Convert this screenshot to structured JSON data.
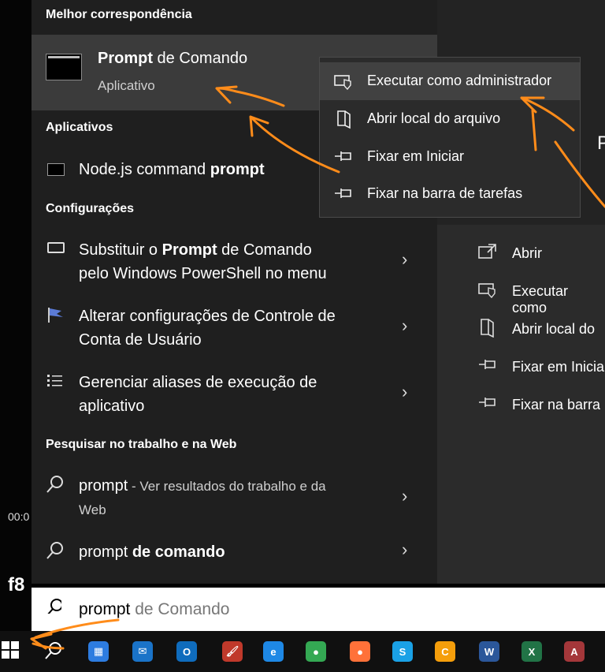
{
  "left_strip": {
    "time": "00:0",
    "code": "f8"
  },
  "menu": {
    "best_match_label": "Melhor correspondência",
    "best_match": {
      "title_bold": "Prompt",
      "title_rest": " de Comando",
      "subtitle": "Aplicativo"
    },
    "apps_label": "Aplicativos",
    "apps": [
      {
        "text_plain": "Node.js command ",
        "text_bold": "prompt"
      }
    ],
    "settings_label": "Configurações",
    "settings": [
      {
        "line1_pre": "Substituir o ",
        "line1_bold": "Prompt",
        "line1_post": " de Comando",
        "line2": "pelo Windows PowerShell no menu"
      },
      {
        "line1": "Alterar configurações de Controle de",
        "line2": "Conta de Usuário"
      },
      {
        "line1": "Gerenciar aliases de execução de",
        "line2": "aplicativo"
      }
    ],
    "web_label": "Pesquisar no trabalho e na Web",
    "web": [
      {
        "bold": "prompt",
        "rest": " - Ver resultados do trabalho e da",
        "line2": "Web"
      },
      {
        "pre": "prompt ",
        "bold": "de comando"
      }
    ],
    "chevron": "›"
  },
  "context_menu": [
    {
      "label": "Executar como administrador",
      "icon": "shield-icon"
    },
    {
      "label": "Abrir local do arquivo",
      "icon": "folder-icon"
    },
    {
      "label": "Fixar em Iniciar",
      "icon": "pin-icon"
    },
    {
      "label": "Fixar na barra de tarefas",
      "icon": "pin-icon"
    }
  ],
  "right_panel": {
    "title_partial": "P",
    "actions": [
      {
        "label": "Abrir",
        "icon": "open-icon"
      },
      {
        "label": "Executar como",
        "icon": "shield-icon"
      },
      {
        "label": "Abrir local do",
        "icon": "folder-icon"
      },
      {
        "label": "Fixar em Inicia",
        "icon": "pin-icon"
      },
      {
        "label": "Fixar na barra",
        "icon": "pin-icon"
      }
    ]
  },
  "search": {
    "typed": "prompt",
    "hint": " de Comando"
  },
  "taskbar": {
    "icons": [
      {
        "name": "start-icon",
        "color": "#ffffff"
      },
      {
        "name": "search-icon",
        "color": "#ffffff"
      },
      {
        "name": "store-icon",
        "color": "#2d7ce0",
        "glyph": "▦"
      },
      {
        "name": "mail-icon",
        "color": "#1a73c8",
        "glyph": "✉"
      },
      {
        "name": "outlook-icon",
        "color": "#0f6cbd",
        "glyph": "O"
      },
      {
        "name": "paint-icon",
        "color": "#c0392b",
        "glyph": "🖌"
      },
      {
        "name": "edge-icon",
        "color": "#1e88e5",
        "glyph": "e"
      },
      {
        "name": "chrome-icon",
        "color": "#34a853",
        "glyph": "●"
      },
      {
        "name": "firefox-icon",
        "color": "#ff7139",
        "glyph": "●"
      },
      {
        "name": "skype-icon",
        "color": "#1aa1e6",
        "glyph": "S"
      },
      {
        "name": "app-c-icon",
        "color": "#f59e0b",
        "glyph": "C"
      },
      {
        "name": "word-icon",
        "color": "#2b579a",
        "glyph": "W"
      },
      {
        "name": "excel-icon",
        "color": "#217346",
        "glyph": "X"
      },
      {
        "name": "access-icon",
        "color": "#a4373a",
        "glyph": "A"
      }
    ]
  },
  "colors": {
    "panel": "#1f1f1f",
    "highlight": "#3b3b3b",
    "annotation": "#ff8c1a"
  }
}
